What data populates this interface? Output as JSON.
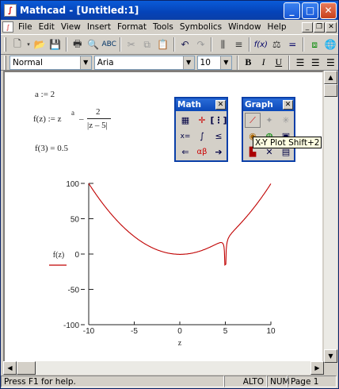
{
  "window": {
    "title": "Mathcad - [Untitled:1]"
  },
  "window_controls": {
    "minimize": "_",
    "maximize": "□",
    "close": "✕"
  },
  "menu": [
    "File",
    "Edit",
    "View",
    "Insert",
    "Format",
    "Tools",
    "Symbolics",
    "Window",
    "Help"
  ],
  "format_bar": {
    "style": "Normal",
    "font": "Aria",
    "size": "10",
    "bold": "B",
    "italic": "I",
    "underline": "U"
  },
  "worksheet": {
    "line1": "a := 2",
    "line2_lhs": "f(z) := z",
    "line2_exp": "a",
    "line2_minus": "–",
    "line2_num": "2",
    "line2_den": "|z – 5|",
    "line3": "f(3) = 0.5"
  },
  "palettes": {
    "math_title": "Math",
    "graph_title": "Graph",
    "close": "✕"
  },
  "tooltip": "X-Y Plot Shift+2",
  "status": {
    "message": "Press F1 for help.",
    "alt": "ALTO",
    "num": "NUM",
    "page": "Page 1"
  },
  "chart_data": {
    "type": "line",
    "function_expression": "f(z) = z^2 - 2/|z-5|",
    "x": [
      -10,
      -9,
      -8,
      -7,
      -6,
      -5,
      -4,
      -3,
      -2,
      -1,
      0,
      1,
      2,
      3,
      4,
      4.5,
      4.8,
      4.95,
      5.05,
      5.2,
      5.5,
      6,
      7,
      8,
      9,
      10
    ],
    "y": [
      99.87,
      80.86,
      63.85,
      48.83,
      35.82,
      24.8,
      15.78,
      8.75,
      3.71,
      0.67,
      -0.4,
      0.5,
      3.33,
      8.0,
      14.0,
      16.25,
      13.04,
      -15.5,
      -14.5,
      17.04,
      26.25,
      34.0,
      48.0,
      63.33,
      80.5,
      99.6
    ],
    "xlim": [
      -10,
      10
    ],
    "ylim": [
      -100,
      100
    ],
    "xticks": [
      "-10",
      "-5",
      "0",
      "5",
      "10"
    ],
    "yticks": [
      "100",
      "50",
      "0",
      "-50",
      "-100"
    ],
    "ylabel": "f(z)",
    "xlabel": "z",
    "series_color": "#c00000"
  }
}
